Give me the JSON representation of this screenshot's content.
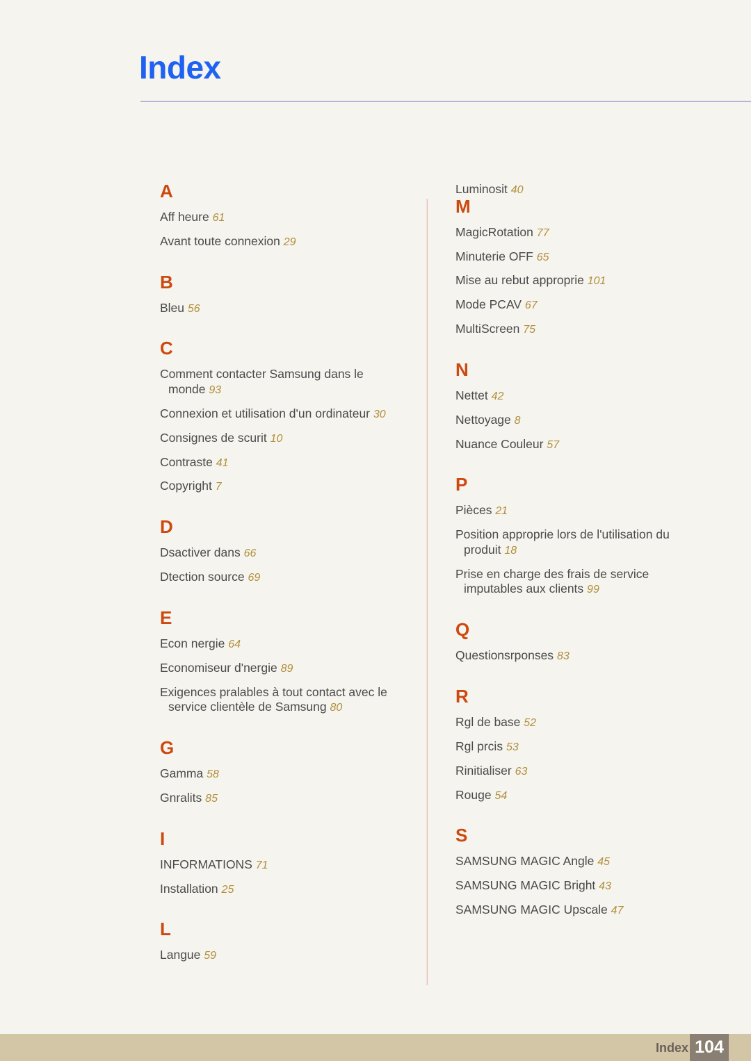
{
  "header": {
    "title": "Index"
  },
  "footer": {
    "label": "Index",
    "page_number": "104"
  },
  "colors": {
    "background": "#f6f4ee",
    "title": "#1f62f2",
    "title_rule": "#b9b2d8",
    "letter_heading": "#cc4910",
    "entry_text": "#4a4a4a",
    "page_ref": "#b08f3c",
    "footer_band": "#d3c6a6",
    "footer_pagebox": "#897f72",
    "column_divider": "#e8bcbc"
  },
  "left_column": {
    "sections": [
      {
        "letter": "A",
        "entries": [
          {
            "text": "Aff heure",
            "page": "61"
          },
          {
            "text": "Avant toute connexion",
            "page": "29"
          }
        ]
      },
      {
        "letter": "B",
        "entries": [
          {
            "text": "Bleu",
            "page": "56"
          }
        ]
      },
      {
        "letter": "C",
        "entries": [
          {
            "text": "Comment contacter Samsung dans le",
            "cont": "monde",
            "page": "93"
          },
          {
            "text": "Connexion et utilisation d'un ordinateur",
            "page": "30"
          },
          {
            "text": "Consignes de scurit",
            "page": "10"
          },
          {
            "text": "Contraste",
            "page": "41"
          },
          {
            "text": "Copyright",
            "page": "7"
          }
        ]
      },
      {
        "letter": "D",
        "entries": [
          {
            "text": "Dsactiver dans",
            "page": "66"
          },
          {
            "text": "Dtection source",
            "page": "69"
          }
        ]
      },
      {
        "letter": "E",
        "entries": [
          {
            "text": "Econ nergie",
            "page": "64"
          },
          {
            "text": "Economiseur d'nergie",
            "page": "89"
          },
          {
            "text": "Exigences pralables à tout contact avec le",
            "cont": "service clientèle de Samsung",
            "page": "80"
          }
        ]
      },
      {
        "letter": "G",
        "entries": [
          {
            "text": "Gamma",
            "page": "58"
          },
          {
            "text": "Gnralits",
            "page": "85"
          }
        ]
      },
      {
        "letter": "I",
        "entries": [
          {
            "text": "INFORMATIONS",
            "page": "71"
          },
          {
            "text": "Installation",
            "page": "25"
          }
        ]
      },
      {
        "letter": "L",
        "entries": [
          {
            "text": "Langue",
            "page": "59"
          }
        ]
      }
    ]
  },
  "right_column": {
    "orphan": {
      "text": "Luminosit",
      "page": "40"
    },
    "sections": [
      {
        "letter": "M",
        "entries": [
          {
            "text": "MagicRotation",
            "page": "77"
          },
          {
            "text": "Minuterie OFF",
            "page": "65"
          },
          {
            "text": "Mise au rebut approprie",
            "page": "101"
          },
          {
            "text": "Mode PCAV",
            "page": "67"
          },
          {
            "text": "MultiScreen",
            "page": "75"
          }
        ]
      },
      {
        "letter": "N",
        "entries": [
          {
            "text": "Nettet",
            "page": "42"
          },
          {
            "text": "Nettoyage",
            "page": "8"
          },
          {
            "text": "Nuance Couleur",
            "page": "57"
          }
        ]
      },
      {
        "letter": "P",
        "entries": [
          {
            "text": "Pièces",
            "page": "21"
          },
          {
            "text": "Position approprie lors de l'utilisation du",
            "cont": "produit",
            "page": "18"
          },
          {
            "text": "Prise en charge des frais de service",
            "cont": "imputables aux clients",
            "page": "99"
          }
        ]
      },
      {
        "letter": "Q",
        "entries": [
          {
            "text": "Questionsrponses",
            "page": "83"
          }
        ]
      },
      {
        "letter": "R",
        "entries": [
          {
            "text": "Rgl de base",
            "page": "52"
          },
          {
            "text": "Rgl prcis",
            "page": "53"
          },
          {
            "text": "Rinitialiser",
            "page": "63"
          },
          {
            "text": "Rouge",
            "page": "54"
          }
        ]
      },
      {
        "letter": "S",
        "entries": [
          {
            "text": "SAMSUNG MAGIC Angle",
            "page": "45"
          },
          {
            "text": "SAMSUNG MAGIC Bright",
            "page": "43"
          },
          {
            "text": "SAMSUNG MAGIC Upscale",
            "page": "47"
          }
        ]
      }
    ]
  }
}
